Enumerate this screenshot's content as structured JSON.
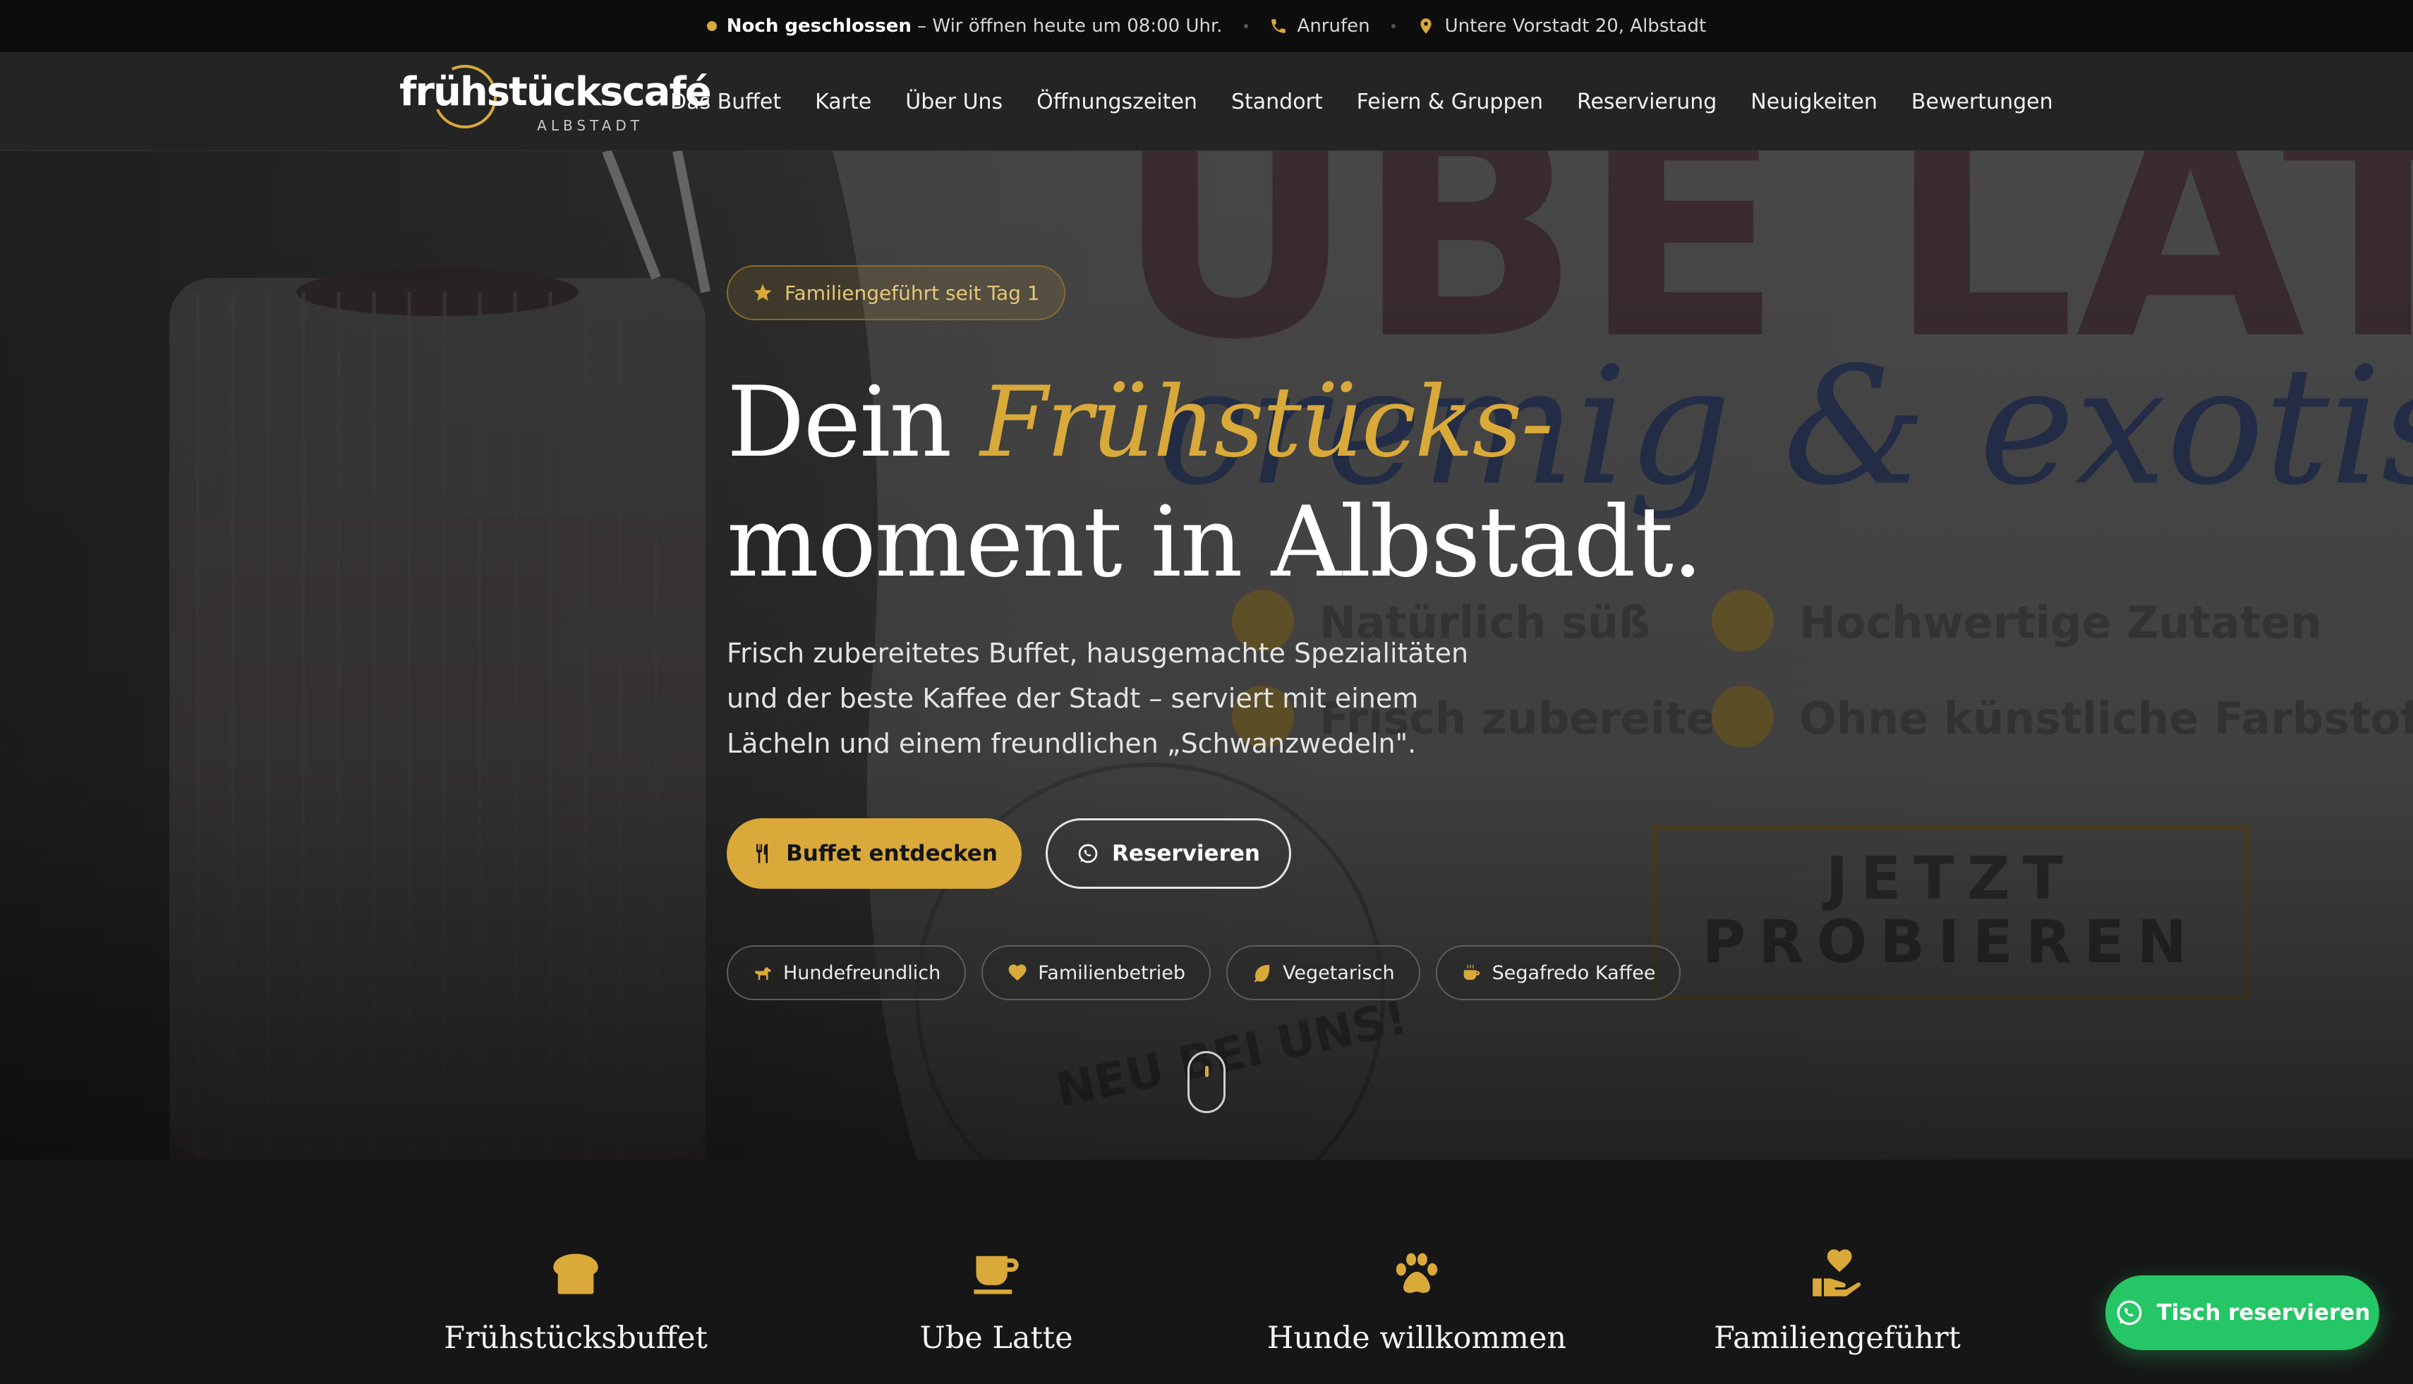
{
  "colors": {
    "accent": "#d9a93a",
    "whatsapp": "#25c665",
    "nav_bg": "#242424",
    "topbar_bg": "#0d0d0d"
  },
  "topbar": {
    "status_strong": "Noch geschlossen",
    "status_text": " – Wir öffnen heute um 08:00 Uhr.",
    "call_label": "Anrufen",
    "address": "Untere Vorstadt 20, Albstadt",
    "icons": [
      "status-dot-icon",
      "phone-icon",
      "map-pin-icon"
    ]
  },
  "logo": {
    "main": "frühstückscafé",
    "sub": "ALBSTADT"
  },
  "nav": {
    "items": [
      "Das Buffet",
      "Karte",
      "Über Uns",
      "Öffnungszeiten",
      "Standort",
      "Feiern & Gruppen",
      "Reservierung",
      "Neuigkeiten",
      "Bewertungen"
    ]
  },
  "hero": {
    "badge": "Familiengeführt seit Tag 1",
    "headline_1": "Dein ",
    "headline_accent": "Frühstücks-",
    "headline_2": "moment in Albstadt.",
    "lead": "Frisch zubereitetes Buffet, hausgemachte Spezialitäten und der beste Kaffee der Stadt – serviert mit einem Lächeln und einem freundlichen „Schwanzwedeln\".",
    "primary_button": "Buffet entdecken",
    "secondary_button": "Reservieren",
    "chips": [
      "Hundefreundlich",
      "Familienbetrieb",
      "Vegetarisch",
      "Segafredo Kaffee"
    ],
    "background_poster": {
      "title": "UBE LATTE",
      "script": "cremig & exotisch",
      "checks": [
        "Natürlich süß",
        "Hochwertige Zutaten",
        "Frisch zubereitet",
        "Ohne künstliche Farbstoffe"
      ],
      "cta": "JETZT PROBIEREN",
      "stamp": "NEU BEI UNS!"
    }
  },
  "features": [
    {
      "label": "Frühstücksbuffet",
      "icon": "bread-icon"
    },
    {
      "label": "Ube Latte",
      "icon": "coffee-cup-icon"
    },
    {
      "label": "Hunde willkommen",
      "icon": "paw-icon"
    },
    {
      "label": "Familiengeführt",
      "icon": "heart-hand-icon"
    }
  ],
  "fab": {
    "label": "Tisch reservieren"
  }
}
